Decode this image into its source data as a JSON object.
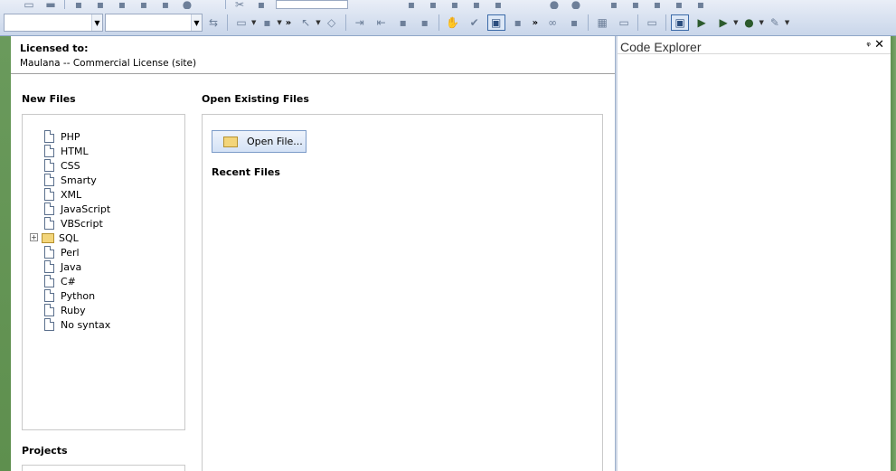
{
  "license": {
    "title": "Licensed to:",
    "text": "Maulana -- Commercial License (site)"
  },
  "new_files": {
    "title": "New Files",
    "items": [
      {
        "label": "PHP",
        "kind": "file"
      },
      {
        "label": "HTML",
        "kind": "file"
      },
      {
        "label": "CSS",
        "kind": "file"
      },
      {
        "label": "Smarty",
        "kind": "file"
      },
      {
        "label": "XML",
        "kind": "file"
      },
      {
        "label": "JavaScript",
        "kind": "file"
      },
      {
        "label": "VBScript",
        "kind": "file"
      },
      {
        "label": "SQL",
        "kind": "folder"
      },
      {
        "label": "Perl",
        "kind": "file"
      },
      {
        "label": "Java",
        "kind": "file"
      },
      {
        "label": "C#",
        "kind": "file"
      },
      {
        "label": "Python",
        "kind": "file"
      },
      {
        "label": "Ruby",
        "kind": "file"
      },
      {
        "label": "No syntax",
        "kind": "file"
      }
    ]
  },
  "open_existing": {
    "title": "Open Existing Files",
    "open_button": "Open File...",
    "recent_title": "Recent Files"
  },
  "projects": {
    "title": "Projects"
  },
  "code_explorer": {
    "title": "Code Explorer",
    "pin_glyph": "ᵠ",
    "close_glyph": "✕"
  },
  "toolbar": {
    "chevron": "»",
    "expand_glyph": "+"
  }
}
